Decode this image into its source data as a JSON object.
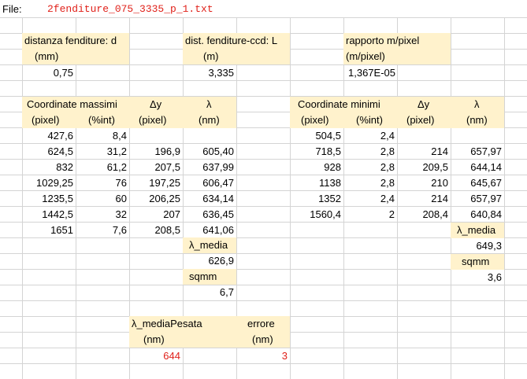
{
  "file": {
    "label": "File:",
    "name": "2fenditure_075_3335_p_1.txt"
  },
  "params": {
    "d_label": "distanza fenditure: d",
    "d_unit": "(mm)",
    "d_value": "0,75",
    "L_label": "dist. fenditure-ccd: L",
    "L_unit": "(m)",
    "L_value": "3,335",
    "r_label": "rapporto m/pixel",
    "r_unit": "(m/pixel)",
    "r_value": "1,367E-05"
  },
  "maxima": {
    "headers": [
      "Coordinate massimi",
      "Δy",
      "λ"
    ],
    "units": [
      "(pixel)",
      "(%int)",
      "(pixel)",
      "(nm)"
    ],
    "rows": [
      [
        "427,6",
        "8,4",
        "",
        ""
      ],
      [
        "624,5",
        "31,2",
        "196,9",
        "605,40"
      ],
      [
        "832",
        "61,2",
        "207,5",
        "637,99"
      ],
      [
        "1029,25",
        "76",
        "197,25",
        "606,47"
      ],
      [
        "1235,5",
        "60",
        "206,25",
        "634,14"
      ],
      [
        "1442,5",
        "32",
        "207",
        "636,45"
      ],
      [
        "1651",
        "7,6",
        "208,5",
        "641,06"
      ]
    ],
    "mean_label": "λ_media",
    "mean_value": "626,9",
    "sq_label": "sqmm",
    "sq_value": "6,7"
  },
  "minima": {
    "headers": [
      "Coordinate minimi",
      "Δy",
      "λ"
    ],
    "units": [
      "(pixel)",
      "(%int)",
      "(pixel)",
      "(nm)"
    ],
    "rows": [
      [
        "504,5",
        "2,4",
        "",
        ""
      ],
      [
        "718,5",
        "2,8",
        "214",
        "657,97"
      ],
      [
        "928",
        "2,8",
        "209,5",
        "644,14"
      ],
      [
        "1138",
        "2,8",
        "210",
        "645,67"
      ],
      [
        "1352",
        "2,4",
        "214",
        "657,97"
      ],
      [
        "1560,4",
        "2",
        "208,4",
        "640,84"
      ]
    ],
    "mean_label": "λ_media",
    "mean_value": "649,3",
    "sq_label": "sqmm",
    "sq_value": "3,6"
  },
  "weighted": {
    "label": "λ_mediaPesata",
    "unit": "(nm)",
    "value": "644",
    "err_label": "errore",
    "err_unit": "(nm)",
    "err_value": "3"
  },
  "colors": {
    "highlight": "#fff2cc",
    "result_red": "#e0211a",
    "grid": "#d4d4d4"
  }
}
